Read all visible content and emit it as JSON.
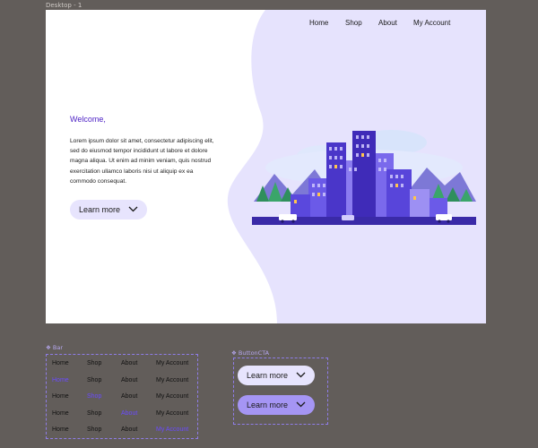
{
  "canvas": {
    "frame_label": "Desktop - 1",
    "background": "#625d5a"
  },
  "nav": {
    "items": [
      "Home",
      "Shop",
      "About",
      "My Account"
    ]
  },
  "hero": {
    "welcome": "Welcome,",
    "body": "Lorem ipsum dolor sit amet, consectetur adipiscing elit, sed do eiusmod tempor incididunt ut labore et dolore magna aliqua. Ut enim ad minim veniam, quis nostrud exercitation ullamco laboris nisi ut aliquip ex ea commodo consequat.",
    "cta_label": "Learn more",
    "cta_icon": "chevron-down-icon",
    "illustration": "city-buildings-illustration"
  },
  "components": {
    "bar": {
      "label": "❖ Bar",
      "rows": [
        {
          "items": [
            "Home",
            "Shop",
            "About",
            "My Account"
          ],
          "active": null
        },
        {
          "items": [
            "Home",
            "Shop",
            "About",
            "My Account"
          ],
          "active": 0
        },
        {
          "items": [
            "Home",
            "Shop",
            "About",
            "My Account"
          ],
          "active": 1
        },
        {
          "items": [
            "Home",
            "Shop",
            "About",
            "My Account"
          ],
          "active": 2
        },
        {
          "items": [
            "Home",
            "Shop",
            "About",
            "My Account"
          ],
          "active": 3
        }
      ]
    },
    "button_cta": {
      "label": "❖ ButtonCTA",
      "variants": [
        {
          "label": "Learn more",
          "state": "default"
        },
        {
          "label": "Learn more",
          "state": "hover"
        }
      ]
    }
  },
  "colors": {
    "accent": "#6a4bff",
    "welcome": "#4b1fc4",
    "blob": "#e6e3fd",
    "cta_default": "#e7e4fd",
    "cta_hover": "#a595f4"
  }
}
